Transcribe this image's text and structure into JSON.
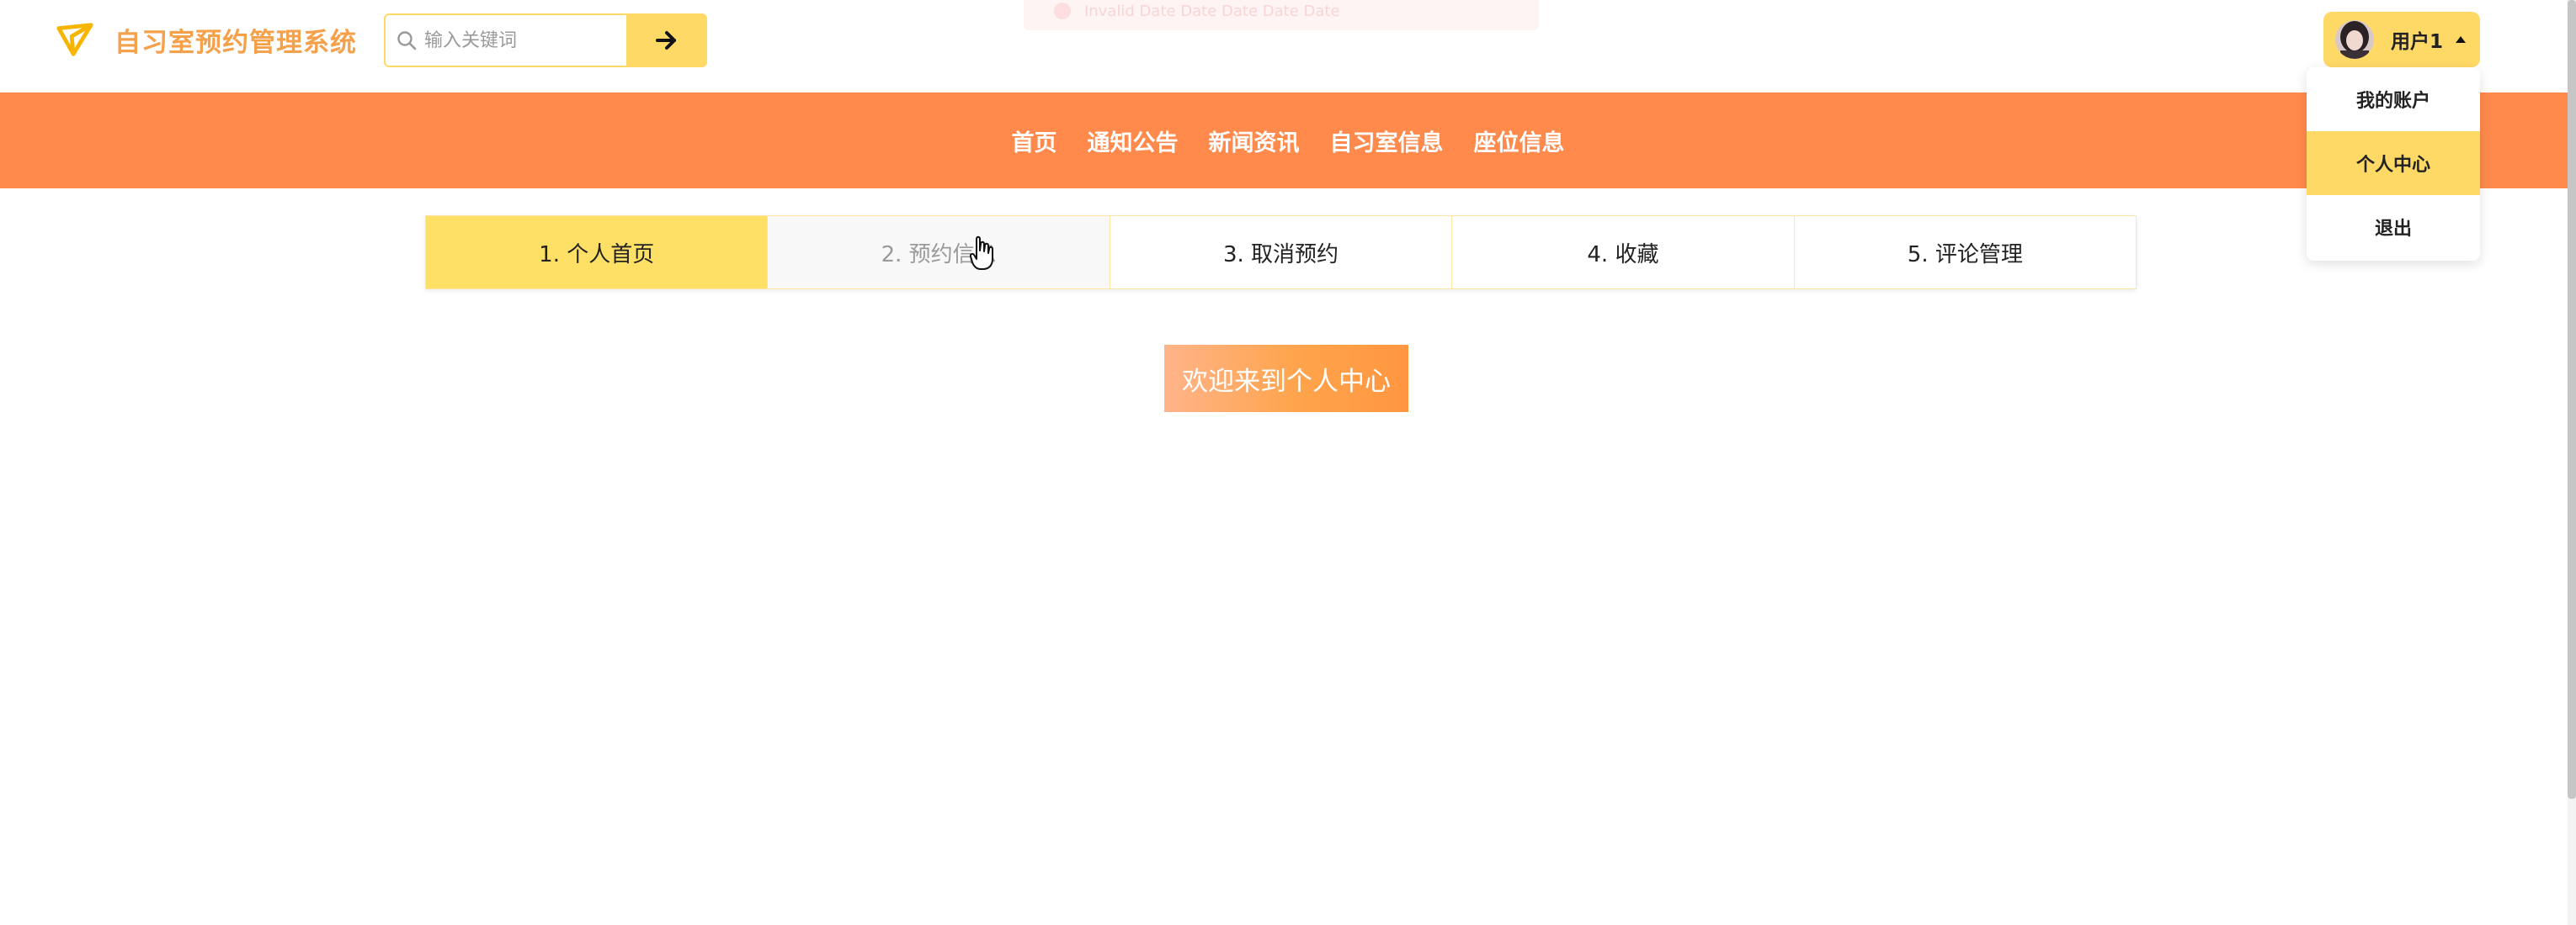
{
  "app": {
    "title": "自习室预约管理系统",
    "brand_color": "#f5a04a"
  },
  "search": {
    "placeholder": "输入关键词",
    "value": ""
  },
  "ghost_toast": {
    "text": "Invalid Date Date Date Date Date"
  },
  "user": {
    "name": "用户1",
    "dropdown": [
      {
        "label": "我的账户",
        "active": false
      },
      {
        "label": "个人中心",
        "active": true
      },
      {
        "label": "退出",
        "active": false
      }
    ]
  },
  "nav": {
    "links": [
      "首页",
      "通知公告",
      "新闻资讯",
      "自习室信息",
      "座位信息"
    ],
    "background": "#ff8a4c"
  },
  "steps": [
    {
      "label": "1. 个人首页",
      "state": "active"
    },
    {
      "label": "2. 预约信息",
      "state": "hover"
    },
    {
      "label": "3. 取消预约",
      "state": "normal"
    },
    {
      "label": "4. 收藏",
      "state": "normal"
    },
    {
      "label": "5. 评论管理",
      "state": "normal"
    }
  ],
  "welcome": {
    "text": "欢迎来到个人中心"
  },
  "icons": {
    "brand": "paper-plane-icon",
    "search": "search-icon",
    "submit": "arrow-right-icon",
    "avatar": "avatar",
    "caret": "caret-up-icon",
    "cursor": "hand-cursor-icon"
  },
  "colors": {
    "accent_yellow": "#ffd966",
    "step_active": "#ffe066"
  }
}
